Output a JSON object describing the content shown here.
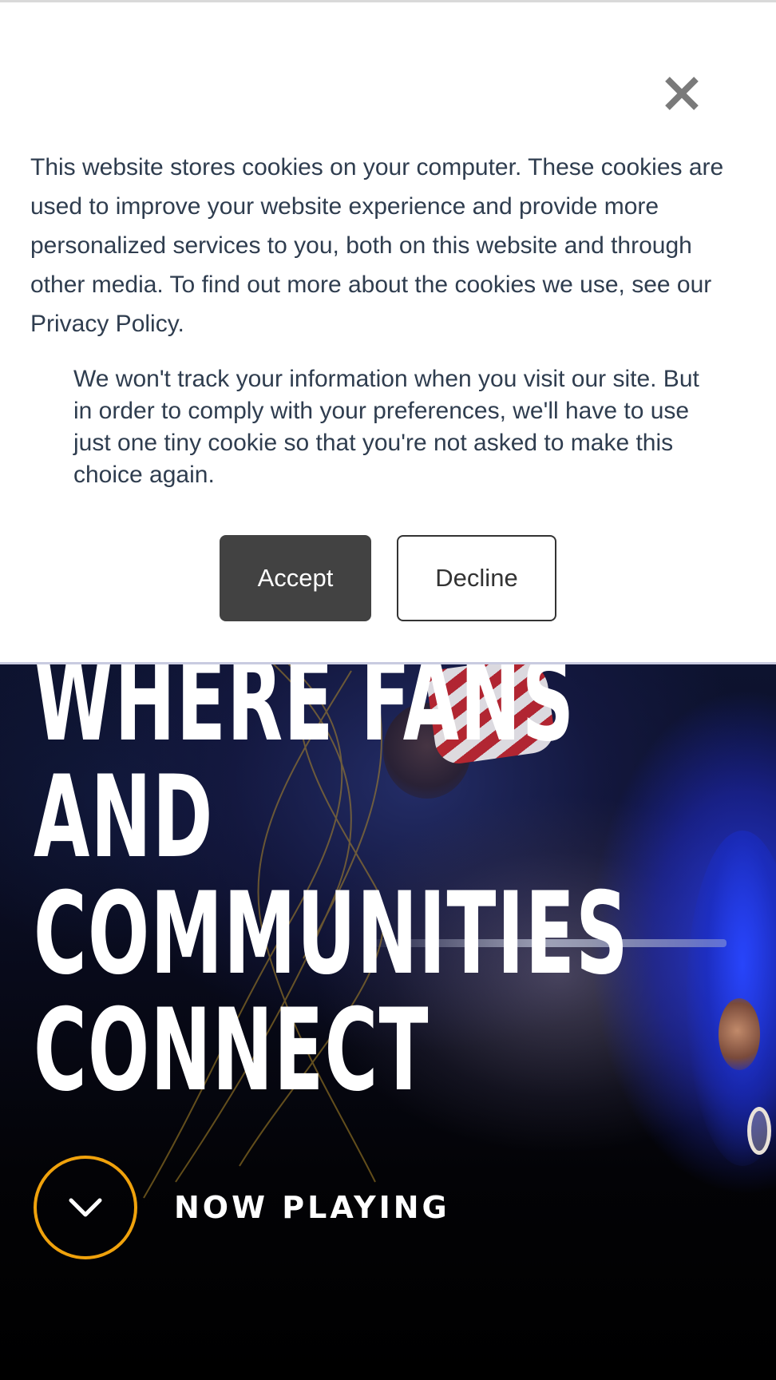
{
  "cookie_banner": {
    "close_icon": "close-icon",
    "message": "This website stores cookies on your computer. These cookies are used to improve your website experience and provide more personalized services to you, both on this website and through other media. To find out more about the cookies we use, see our Privacy Policy.",
    "decline_note": "We won't track your information when you visit our site. But in order to comply with your preferences, we'll have to use just one tiny cookie so that you're not asked to make this choice again.",
    "accept_label": "Accept",
    "decline_label": "Decline"
  },
  "hero": {
    "title_lines": [
      "WHERE FANS",
      "AND",
      "COMMUNITIES",
      "CONNECT"
    ],
    "now_playing": {
      "icon": "chevron-down-icon",
      "label": "NOW PLAYING"
    }
  },
  "colors": {
    "accent_ring": "#f0a20c",
    "accept_bg": "#424242",
    "banner_text": "#2f3d4f"
  }
}
